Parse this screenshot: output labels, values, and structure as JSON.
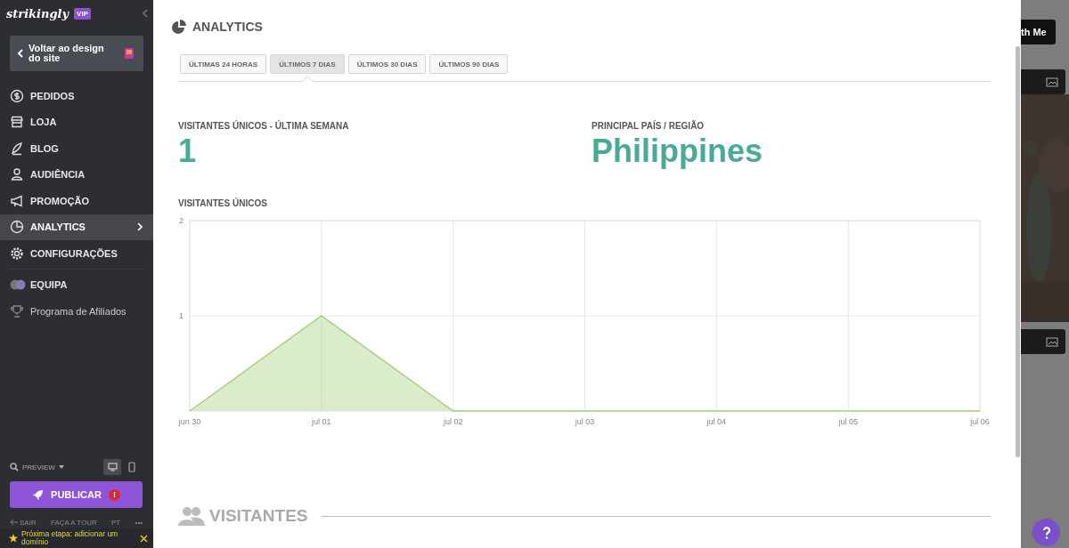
{
  "sidebar": {
    "logo": "strikingly",
    "badge": "VIP",
    "back_button": "Voltar ao design do site",
    "items": [
      {
        "label": "PEDIDOS",
        "selected": false
      },
      {
        "label": "LOJA",
        "selected": false
      },
      {
        "label": "BLOG",
        "selected": false
      },
      {
        "label": "AUDIÊNCIA",
        "selected": false
      },
      {
        "label": "PROMOÇÃO",
        "selected": false
      },
      {
        "label": "ANALYTICS",
        "selected": true
      },
      {
        "label": "CONFIGURAÇÕES",
        "selected": false
      }
    ],
    "extra_items": [
      {
        "label": "EQUIPA",
        "kind": "section"
      },
      {
        "label": "Programa de Afiliados",
        "kind": "link"
      }
    ],
    "preview": "PREVIEW",
    "devices": [
      {
        "kind": "desktop",
        "selected": true
      },
      {
        "kind": "mobile",
        "selected": false
      }
    ],
    "publish": "PUBLICAR",
    "publish_alert": "!",
    "links": [
      "SAIR",
      "FAÇA A TOUR",
      "PT",
      "•••"
    ],
    "banner": "Próxima etapa: adicionar um domínio"
  },
  "main": {
    "title": "ANALYTICS",
    "tabs": [
      {
        "label": "ÚLTIMAS 24 HORAS",
        "selected": false
      },
      {
        "label": "ÚLTIMOS 7 DIAS",
        "selected": true
      },
      {
        "label": "ÚLTIMOS 30 DIAS",
        "selected": false
      },
      {
        "label": "ÚLTIMOS 90 DIAS",
        "selected": false
      }
    ],
    "stats": [
      {
        "label": "VISITANTES ÚNICOS - ÚLTIMA SEMANA",
        "value": "1"
      },
      {
        "label": "PRINCIPAL PAÍS / REGIÃO",
        "value": "Philippines"
      }
    ],
    "chart_title": "VISITANTES ÚNICOS",
    "chart_data": {
      "type": "area",
      "categories": [
        "jun 30",
        "jul 01",
        "jul 02",
        "jul 03",
        "jul 04",
        "jul 05",
        "jul 06"
      ],
      "series": [
        {
          "color": "#a5cf7c",
          "values": [
            0,
            1,
            0,
            0,
            0,
            0,
            0
          ]
        }
      ],
      "ylim": [
        0,
        2
      ],
      "yticks": [
        1,
        2
      ],
      "grid": true
    },
    "section_title": "VISITANTES"
  },
  "preview_strip": {
    "button": "th Me"
  }
}
